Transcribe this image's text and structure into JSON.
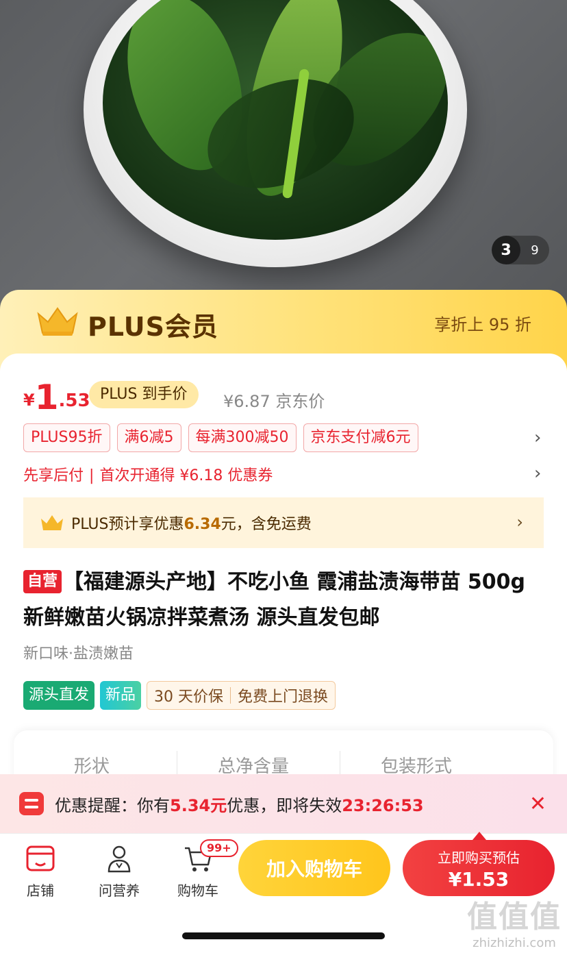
{
  "gallery": {
    "current": "3",
    "total": "9"
  },
  "plus_banner": {
    "title": "PLUS会员",
    "discount_text": "享折上 95 折"
  },
  "price": {
    "currency": "¥",
    "integer": "1",
    "decimal": ".53",
    "plus_pill": "PLUS 到手价",
    "jd_price": "¥6.87 京东价"
  },
  "coupons": [
    "PLUS95折",
    "满6减5",
    "每满300减50",
    "京东支付减6元"
  ],
  "credit": {
    "left": "先享后付",
    "right": "首次开通得 ¥6.18 优惠券"
  },
  "plus_save": {
    "prefix": "PLUS预计享优惠",
    "amount": "6.34",
    "suffix": "元，含免运费"
  },
  "product": {
    "self_badge": "自营",
    "title": "【福建源头产地】不吃小鱼 霞浦盐渍海带苗 500g 新鲜嫩苗火锅凉拌菜煮汤 源头直发包邮",
    "variant": "新口味·盐渍嫩苗",
    "tags": [
      "源头直发",
      "新品"
    ],
    "services": [
      "30 天价保",
      "免费上门退换"
    ]
  },
  "specs": [
    "形状",
    "总净含量",
    "包装形式"
  ],
  "reminder": {
    "prefix": "优惠提醒：你有",
    "amount": "5.34元",
    "middle": "优惠，即将失效",
    "countdown": "23:26:53"
  },
  "bottom_nav": [
    {
      "label": "店铺",
      "icon": "store-icon"
    },
    {
      "label": "问营养",
      "icon": "nutritionist-icon"
    },
    {
      "label": "购物车",
      "icon": "cart-icon"
    }
  ],
  "cart_badge": "99+",
  "buttons": {
    "add_to_cart": "加入购物车",
    "buy_line1": "立即购买预估",
    "buy_line2": "¥1.53"
  },
  "watermark": {
    "big": "值值值",
    "small": "zhizhizhi.com"
  },
  "colors": {
    "accent_red": "#e8232f",
    "plus_gold": "#ffd44a",
    "cart_yellow": "#ffc51c"
  }
}
